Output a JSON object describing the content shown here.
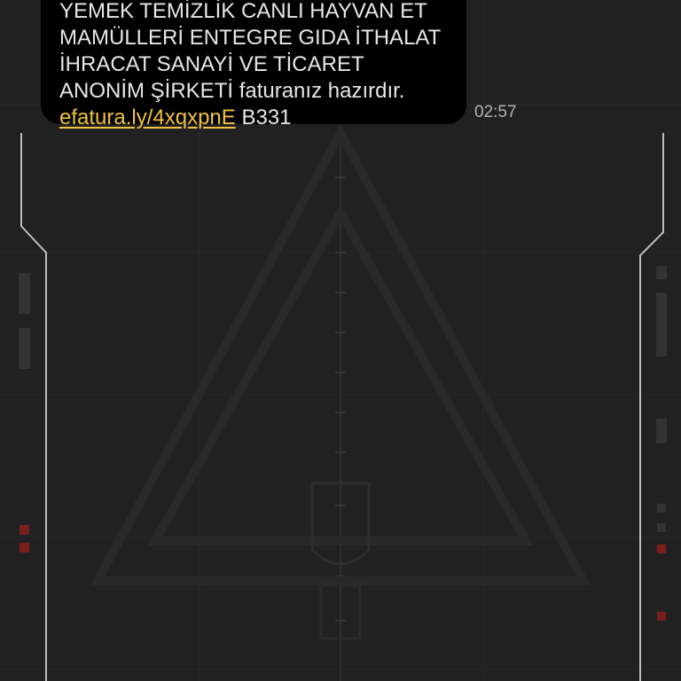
{
  "message": {
    "lines": [
      "YEMEK TEMİZLİK CANLI HAYVAN ET",
      "MAMÜLLERİ ENTEGRE GIDA İTHALAT",
      "İHRACAT SANAYİ VE TİCARET",
      "ANONİM ŞİRKETİ faturanız hazırdır."
    ],
    "link": "efatura.ly/4xqxpnE",
    "code": " B331",
    "time": "02:57"
  },
  "colors": {
    "background": "#212121",
    "bubble": "#000000",
    "text": "#e6e6e6",
    "link": "#f2c141",
    "time": "#b0b0b0",
    "accent_red": "#7a1d1d"
  }
}
